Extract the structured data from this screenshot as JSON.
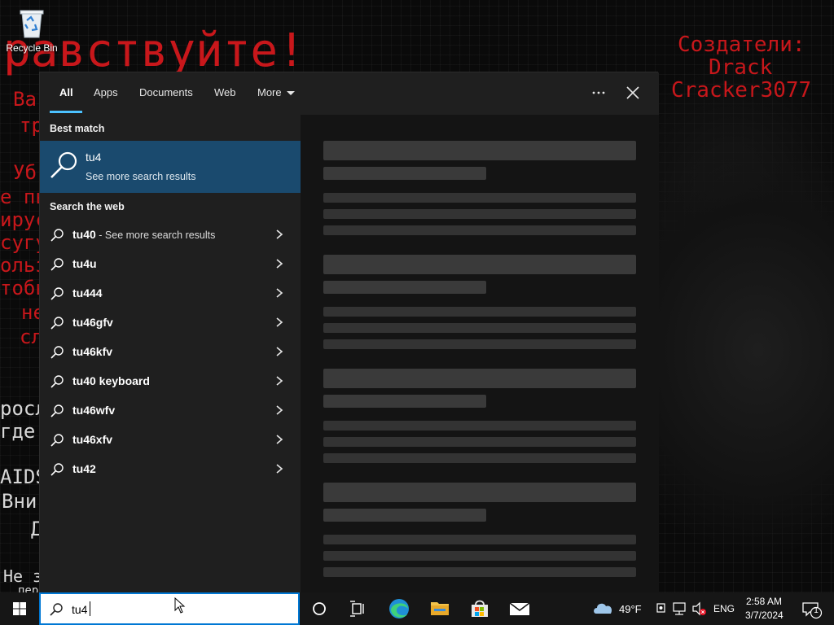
{
  "desktop": {
    "recycle_bin_label": "Recycle Bin",
    "wallpaper_lines": {
      "greeting": "равствуйте!",
      "creators_title": "Создатели:",
      "creator_1": "Drack",
      "creator_2": "Cracker3077",
      "frag_va": "Ва",
      "frag_tr": "тр",
      "frag_ub": "Уб",
      "frag_e_py": "е пь",
      "frag_irus": "ирус",
      "frag_sugu": "сугу",
      "frag_olb": "ольз",
      "frag_tob": "тобь",
      "frag_ne": "не",
      "frag_sl": "сл",
      "frag_rosl": "росл",
      "frag_gde": "где",
      "frag_aids": "AIDS",
      "frag_vni": "Вни",
      "frag_d": "Д",
      "frag_ne_z": "Не з",
      "frag_per": "пер"
    }
  },
  "search_panel": {
    "tabs": [
      {
        "label": "All"
      },
      {
        "label": "Apps"
      },
      {
        "label": "Documents"
      },
      {
        "label": "Web"
      },
      {
        "label": "More"
      }
    ],
    "best_match_heading": "Best match",
    "best_match": {
      "title": "tu4",
      "subtitle": "See more search results"
    },
    "web_heading": "Search the web",
    "web_results": [
      {
        "text": "tu40",
        "suffix": " - See more search results"
      },
      {
        "text": "tu4u",
        "suffix": ""
      },
      {
        "text": "tu444",
        "suffix": ""
      },
      {
        "text": "tu46gfv",
        "suffix": ""
      },
      {
        "text": "tu46kfv",
        "suffix": ""
      },
      {
        "text": "tu40 keyboard",
        "suffix": ""
      },
      {
        "text": "tu46wfv",
        "suffix": ""
      },
      {
        "text": "tu46xfv",
        "suffix": ""
      },
      {
        "text": "tu42",
        "suffix": ""
      }
    ]
  },
  "taskbar": {
    "search_value": "tu4",
    "weather_temp": "49°F",
    "language": "ENG",
    "time": "2:58 AM",
    "date": "3/7/2024",
    "notification_count": "1"
  },
  "colors": {
    "accent": "#0078d4",
    "highlight": "#1a4a6e",
    "tab_underline": "#4cc2ff",
    "wallpaper_red": "#c8171b"
  }
}
